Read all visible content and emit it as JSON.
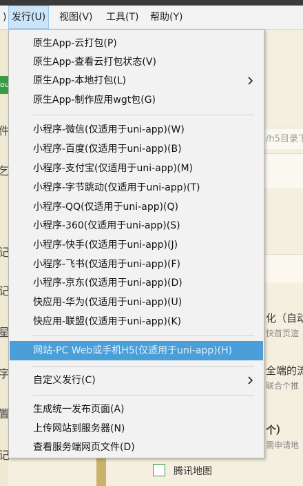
{
  "menubar": {
    "items": [
      {
        "label": ")"
      },
      {
        "label": "发行(U)"
      },
      {
        "label": "视图(V)"
      },
      {
        "label": "工具(T)"
      },
      {
        "label": "帮助(Y)"
      }
    ]
  },
  "background": {
    "left_chars": [
      "ou",
      "件",
      "乞",
      "记",
      "记",
      "星",
      "字",
      "置",
      "记"
    ],
    "right_texts": [
      "/h5目录下",
      "化（自动",
      "快首页渲",
      "全端的流",
      "联合个推",
      "个）",
      "需申请地"
    ],
    "checkbox_label": "腾讯地图"
  },
  "dropdown": {
    "items": [
      {
        "label": "原生App-云打包(P)"
      },
      {
        "label": "原生App-查看云打包状态(V)"
      },
      {
        "label": "原生App-本地打包(L)"
      },
      {
        "label": "原生App-制作应用wgt包(G)"
      },
      {
        "label": "小程序-微信(仅适用于uni-app)(W)"
      },
      {
        "label": "小程序-百度(仅适用于uni-app)(B)"
      },
      {
        "label": "小程序-支付宝(仅适用于uni-app)(M)"
      },
      {
        "label": "小程序-字节跳动(仅适用于uni-app)(T)"
      },
      {
        "label": "小程序-QQ(仅适用于uni-app)(Q)"
      },
      {
        "label": "小程序-360(仅适用于uni-app)(S)"
      },
      {
        "label": "小程序-快手(仅适用于uni-app)(J)"
      },
      {
        "label": "小程序-飞书(仅适用于uni-app)(F)"
      },
      {
        "label": "小程序-京东(仅适用于uni-app)(D)"
      },
      {
        "label": "快应用-华为(仅适用于uni-app)(U)"
      },
      {
        "label": "快应用-联盟(仅适用于uni-app)(K)"
      },
      {
        "label": "网站-PC Web或手机H5(仅适用于uni-app)(H)"
      },
      {
        "label": "自定义发行(C)"
      },
      {
        "label": "生成统一发布页面(A)"
      },
      {
        "label": "上传网站到服务器(N)"
      },
      {
        "label": "查看服务端网页文件(D)"
      }
    ]
  },
  "colors": {
    "highlight": "#4a9fd8",
    "accent_green": "#3a9a46"
  }
}
